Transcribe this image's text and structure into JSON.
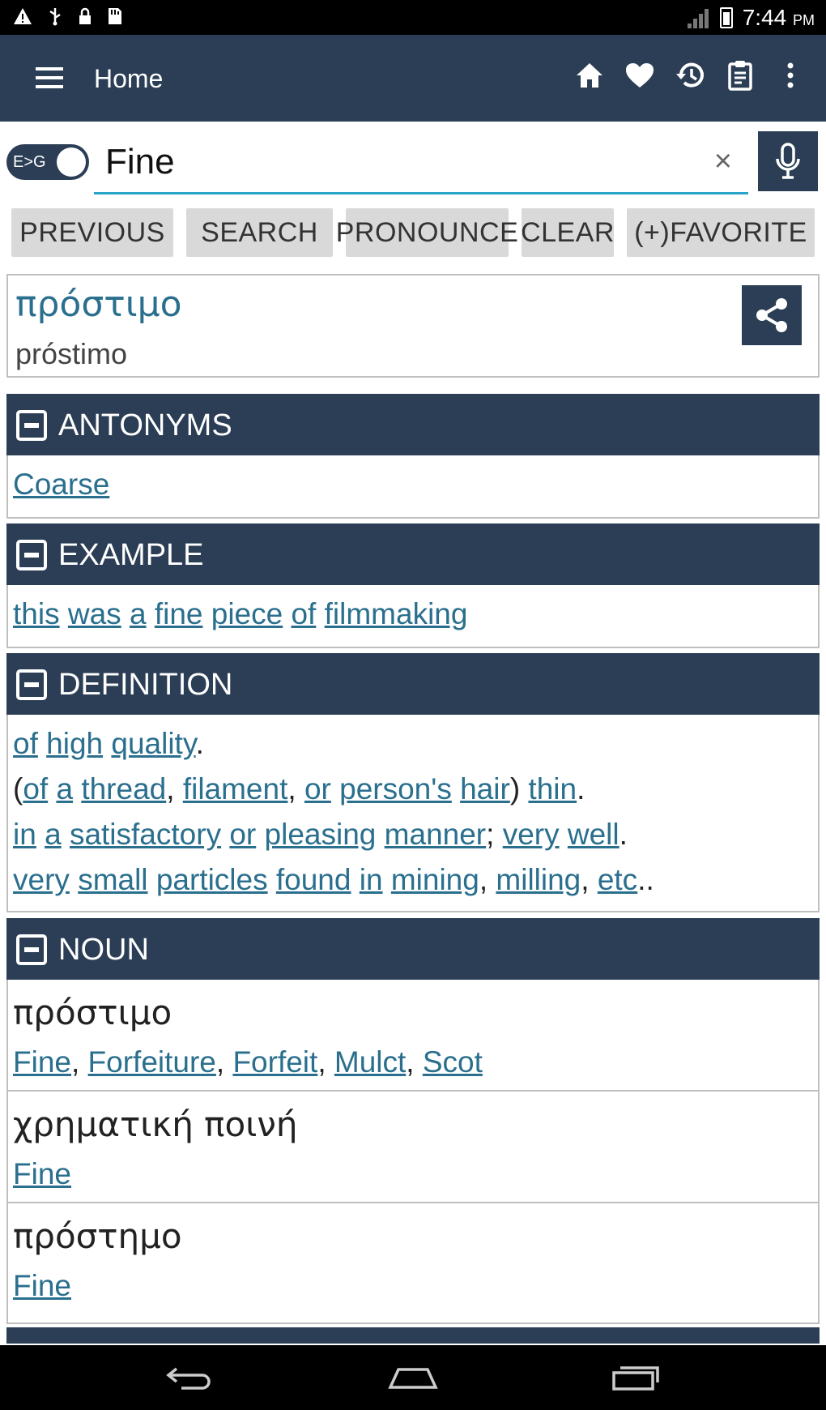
{
  "status_bar": {
    "time": "7:44",
    "ampm": "PM",
    "left_icons": [
      "warning-icon",
      "usb-icon",
      "lock-icon",
      "sd-card-icon"
    ]
  },
  "app_bar": {
    "title": "Home",
    "actions": [
      "home-icon",
      "heart-icon",
      "history-icon",
      "clipboard-icon",
      "more-vert-icon"
    ]
  },
  "search": {
    "toggle_label": "E>G",
    "value": "Fine",
    "clear_symbol": "×"
  },
  "buttons": {
    "previous": "PREVIOUS",
    "search": "SEARCH",
    "pronounce": "PRONOUNCE",
    "clear": "CLEAR",
    "favorite": "(+)FAVORITE"
  },
  "result": {
    "word": "πρόστιμο",
    "transliteration": "próstimo"
  },
  "sections": {
    "antonyms": {
      "title": "ANTONYMS",
      "items": [
        "Coarse"
      ]
    },
    "example": {
      "title": "EXAMPLE",
      "words": [
        "this",
        "was",
        "a",
        "fine",
        "piece",
        "of",
        "filmmaking"
      ]
    },
    "definition": {
      "title": "DEFINITION",
      "lines": [
        [
          [
            "of",
            true
          ],
          [
            " ",
            false
          ],
          [
            "high",
            true
          ],
          [
            " ",
            false
          ],
          [
            "quality",
            true
          ],
          [
            ".",
            false
          ]
        ],
        [
          [
            "(",
            false
          ],
          [
            "of",
            true
          ],
          [
            " ",
            false
          ],
          [
            "a",
            true
          ],
          [
            " ",
            false
          ],
          [
            "thread",
            true
          ],
          [
            ", ",
            false
          ],
          [
            "filament",
            true
          ],
          [
            ", ",
            false
          ],
          [
            "or",
            true
          ],
          [
            " ",
            false
          ],
          [
            "person's",
            true
          ],
          [
            " ",
            false
          ],
          [
            "hair",
            true
          ],
          [
            ") ",
            false
          ],
          [
            "thin",
            true
          ],
          [
            ".",
            false
          ]
        ],
        [
          [
            "in",
            true
          ],
          [
            " ",
            false
          ],
          [
            "a",
            true
          ],
          [
            " ",
            false
          ],
          [
            "satisfactory",
            true
          ],
          [
            " ",
            false
          ],
          [
            "or",
            true
          ],
          [
            " ",
            false
          ],
          [
            "pleasing",
            true
          ],
          [
            " ",
            false
          ],
          [
            "manner",
            true
          ],
          [
            "; ",
            false
          ],
          [
            "very",
            true
          ],
          [
            " ",
            false
          ],
          [
            "well",
            true
          ],
          [
            ".",
            false
          ]
        ],
        [
          [
            "very",
            true
          ],
          [
            " ",
            false
          ],
          [
            "small",
            true
          ],
          [
            " ",
            false
          ],
          [
            "particles",
            true
          ],
          [
            " ",
            false
          ],
          [
            "found",
            true
          ],
          [
            " ",
            false
          ],
          [
            "in",
            true
          ],
          [
            " ",
            false
          ],
          [
            "mining",
            true
          ],
          [
            ", ",
            false
          ],
          [
            "milling",
            true
          ],
          [
            ", ",
            false
          ],
          [
            "etc",
            true
          ],
          [
            "..",
            false
          ]
        ]
      ]
    },
    "noun": {
      "title": "NOUN",
      "entries": [
        {
          "word": "πρόστιμο",
          "translations": [
            "Fine",
            "Forfeiture",
            "Forfeit",
            "Mulct",
            "Scot"
          ]
        },
        {
          "word": "χρηματική ποινή",
          "translations": [
            "Fine"
          ]
        },
        {
          "word": "πρόστημο",
          "translations": [
            "Fine"
          ]
        }
      ]
    }
  },
  "colors": {
    "primary": "#2b3e55",
    "link": "#2a6f8e",
    "accent": "#2aa3c9",
    "button_bg": "#d9d9d9"
  }
}
